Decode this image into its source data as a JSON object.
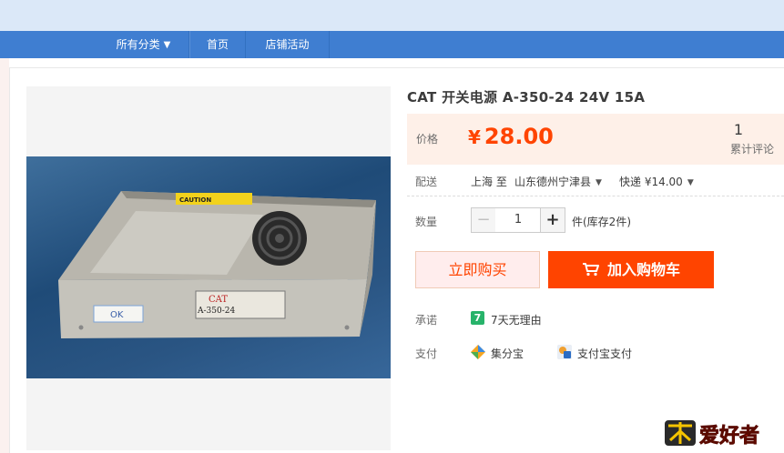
{
  "nav": {
    "items": [
      "所有分类",
      "首页",
      "店铺活动"
    ]
  },
  "product": {
    "title": "CAT 开关电源 A-350-24 24V 15A",
    "image_text": {
      "caution": "CAUTION",
      "brand": "CAT",
      "model": "A-350-24",
      "tag": "OK"
    }
  },
  "price": {
    "label": "价格",
    "currency": "¥",
    "value": "28.00",
    "review_count": "1",
    "review_label": "累计评论"
  },
  "shipping": {
    "label": "配送",
    "from": "上海 至",
    "to": "山东德州宁津县",
    "method": "快递 ¥14.00"
  },
  "quantity": {
    "label": "数量",
    "value": "1",
    "minus": "−",
    "plus": "+",
    "stock": "件(库存2件)"
  },
  "buttons": {
    "buy_now": "立即购买",
    "add_to_cart": "加入购物车"
  },
  "promise": {
    "label": "承诺",
    "badge": "7",
    "text": "7天无理由"
  },
  "payment": {
    "label": "支付",
    "option1": "集分宝",
    "option2": "支付宝支付"
  },
  "watermark": {
    "text": "爱好者"
  },
  "colors": {
    "nav_bg": "#3f7ed1",
    "accent": "#ff4400",
    "price": "#ff4400",
    "price_panel": "#fef0e8"
  },
  "icons": {
    "nav_caret": "caret-down-icon",
    "dropdown": "dropdown-arrow-icon",
    "cart": "cart-icon",
    "promise": "seven-day-badge-icon",
    "pay1": "jifenbao-icon",
    "pay2": "alipay-icon"
  }
}
